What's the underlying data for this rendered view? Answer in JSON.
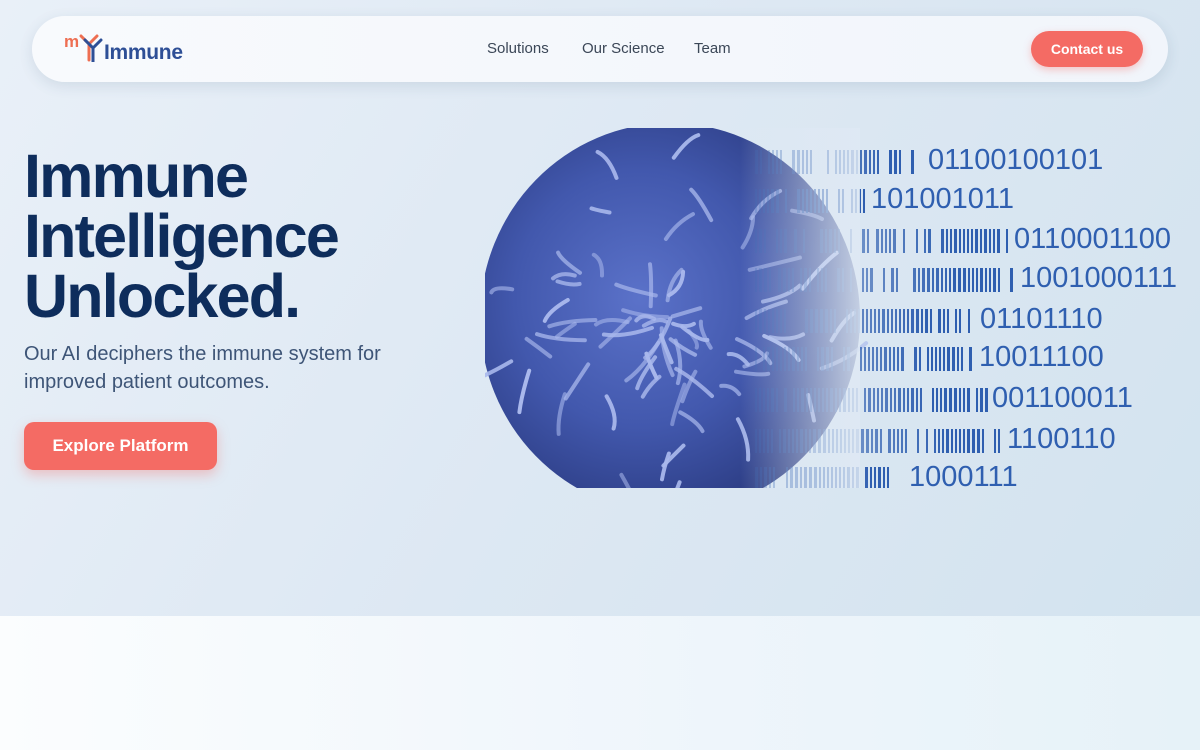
{
  "nav": {
    "logo_prefix": "m",
    "logo_text": "Immune",
    "links": [
      "Solutions",
      "Our Science",
      "Team"
    ],
    "contact_label": "Contact us"
  },
  "hero": {
    "headline_lines": [
      "Immune",
      "Intelligence",
      "Unlocked."
    ],
    "subtitle": "Our AI deciphers the immune system for improved patient outcomes.",
    "cta_label": "Explore Platform"
  },
  "binary_rows": [
    "01100100101",
    "101001011",
    "0110001100",
    "1001000111",
    "01101110",
    "10011100",
    "001100011",
    "1100110",
    "1000111"
  ],
  "colors": {
    "accent": "#f46b64",
    "headline": "#0e2d5c",
    "brand_blue": "#2e4f96",
    "binary": "#2f5fb0"
  },
  "icons": {
    "logo_mark": "antibody-y-icon",
    "hero_image": "immune-cell-illustration"
  }
}
